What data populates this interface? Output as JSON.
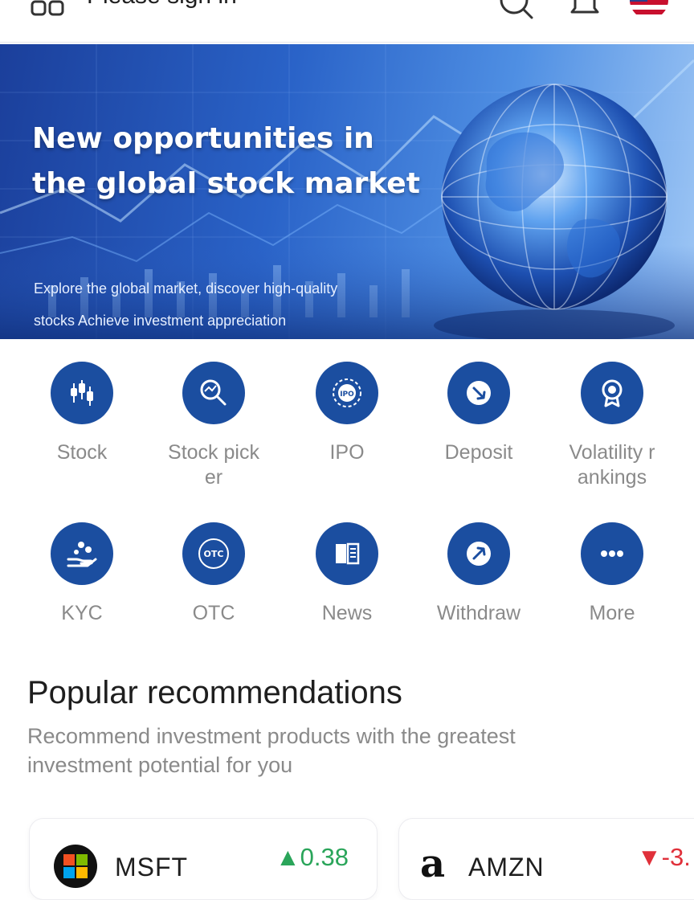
{
  "header": {
    "sign_in_text": "Please sign in",
    "icons": [
      "grid-menu-icon",
      "search-icon",
      "bell-icon",
      "us-flag-icon"
    ]
  },
  "banner": {
    "title_line1": "New opportunities in",
    "title_line2": "the global stock market",
    "subtitle_line1": "Explore the global market, discover high-quality",
    "subtitle_line2": "stocks Achieve investment appreciation"
  },
  "actions": [
    {
      "label": "Stock",
      "icon": "stock-icon"
    },
    {
      "label": "Stock pick\ner",
      "icon": "stock-picker-icon"
    },
    {
      "label": "IPO",
      "icon": "ipo-icon"
    },
    {
      "label": "Deposit",
      "icon": "deposit-icon"
    },
    {
      "label": "Volatility r\nankings",
      "icon": "volatility-rankings-icon"
    },
    {
      "label": "KYC",
      "icon": "kyc-icon"
    },
    {
      "label": "OTC",
      "icon": "otc-icon"
    },
    {
      "label": "News",
      "icon": "news-icon"
    },
    {
      "label": "Withdraw",
      "icon": "withdraw-icon"
    },
    {
      "label": "More",
      "icon": "more-icon"
    }
  ],
  "recommendations": {
    "title": "Popular recommendations",
    "description": "Recommend investment products with the greatest investment potential for you",
    "cards": [
      {
        "symbol": "MSFT",
        "change": "▲0.38",
        "direction": "up"
      },
      {
        "symbol": "AMZN",
        "change": "▼-3.",
        "direction": "down"
      }
    ]
  },
  "colors": {
    "primary": "#1b4ea0",
    "up": "#2aa55a",
    "down": "#e0303a",
    "label_gray": "#8a8a8a"
  }
}
